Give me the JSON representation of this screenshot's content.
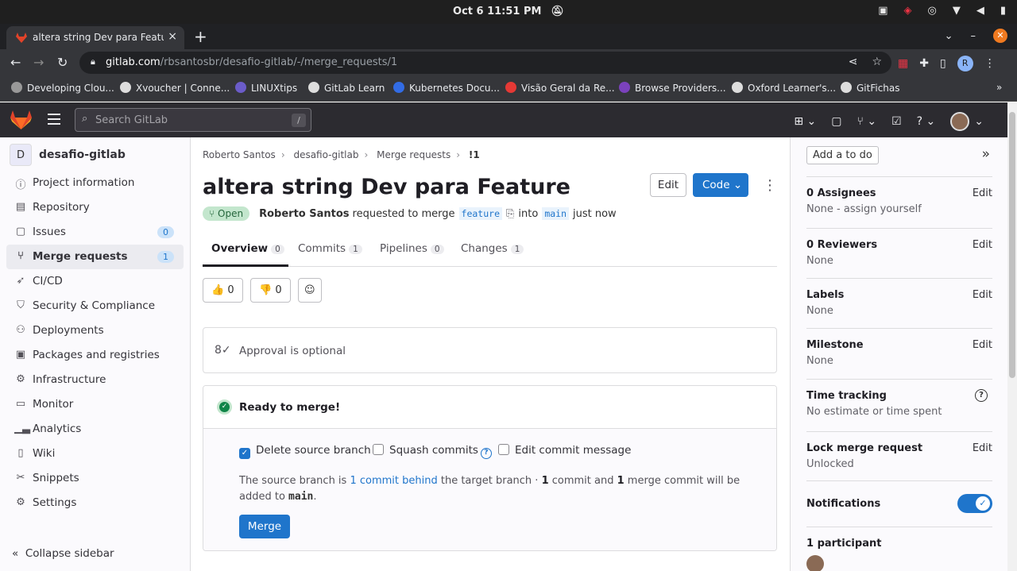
{
  "os": {
    "clock": "Oct 6  11:51 PM"
  },
  "browser": {
    "tab_title": "altera string Dev para Feature",
    "url_host": "gitlab.com",
    "url_path": "/rbsantosbr/desafio-gitlab/-/merge_requests/1",
    "bookmarks": [
      "Developing Clou...",
      "Xvoucher | Conne...",
      "LINUXtips",
      "GitLab Learn",
      "Kubernetes Docu...",
      "Visão Geral da Re...",
      "Browse Providers...",
      "Oxford Learner's...",
      "GitFichas"
    ]
  },
  "header": {
    "search_placeholder": "Search GitLab",
    "search_shortcut": "/"
  },
  "sidebar": {
    "project_initial": "D",
    "project_name": "desafio-gitlab",
    "items": [
      {
        "label": "Project information"
      },
      {
        "label": "Repository"
      },
      {
        "label": "Issues",
        "count": "0"
      },
      {
        "label": "Merge requests",
        "count": "1"
      },
      {
        "label": "CI/CD"
      },
      {
        "label": "Security & Compliance"
      },
      {
        "label": "Deployments"
      },
      {
        "label": "Packages and registries"
      },
      {
        "label": "Infrastructure"
      },
      {
        "label": "Monitor"
      },
      {
        "label": "Analytics"
      },
      {
        "label": "Wiki"
      },
      {
        "label": "Snippets"
      },
      {
        "label": "Settings"
      }
    ],
    "collapse_label": "Collapse sidebar"
  },
  "breadcrumb": [
    "Roberto Santos",
    "desafio-gitlab",
    "Merge requests",
    "!1"
  ],
  "mr": {
    "title": "altera string Dev para Feature",
    "edit_label": "Edit",
    "code_label": "Code",
    "status": "Open",
    "author": "Roberto Santos",
    "requested_text": "requested to merge",
    "source_branch": "feature",
    "into_text": "into",
    "target_branch": "main",
    "time": "just now"
  },
  "tabs": [
    {
      "label": "Overview",
      "count": "0"
    },
    {
      "label": "Commits",
      "count": "1"
    },
    {
      "label": "Pipelines",
      "count": "0"
    },
    {
      "label": "Changes",
      "count": "1"
    }
  ],
  "reactions": {
    "thumbs_up": "0",
    "thumbs_down": "0"
  },
  "approval_text": "Approval is optional",
  "merge": {
    "ready_text": "Ready to merge!",
    "delete_source": "Delete source branch",
    "squash": "Squash commits",
    "edit_message": "Edit commit message",
    "info_1": "The source branch is ",
    "info_link": "1 commit behind",
    "info_2": " the target branch · ",
    "info_n1": "1",
    "info_3": " commit and ",
    "info_n2": "1",
    "info_4": " merge commit will be added to ",
    "info_branch": "main",
    "info_5": ".",
    "button": "Merge"
  },
  "rsidebar": {
    "todo": "Add a to do",
    "assignees_title": "0 Assignees",
    "assignees_value": "None - assign yourself",
    "reviewers_title": "0 Reviewers",
    "reviewers_value": "None",
    "labels_title": "Labels",
    "labels_value": "None",
    "milestone_title": "Milestone",
    "milestone_value": "None",
    "time_title": "Time tracking",
    "time_value": "No estimate or time spent",
    "lock_title": "Lock merge request",
    "lock_value": "Unlocked",
    "notifications_title": "Notifications",
    "participants_title": "1 participant",
    "edit_label": "Edit"
  },
  "colors": {
    "accent": "#1f75cb",
    "success": "#108548",
    "header_bg": "#2c2b30"
  }
}
